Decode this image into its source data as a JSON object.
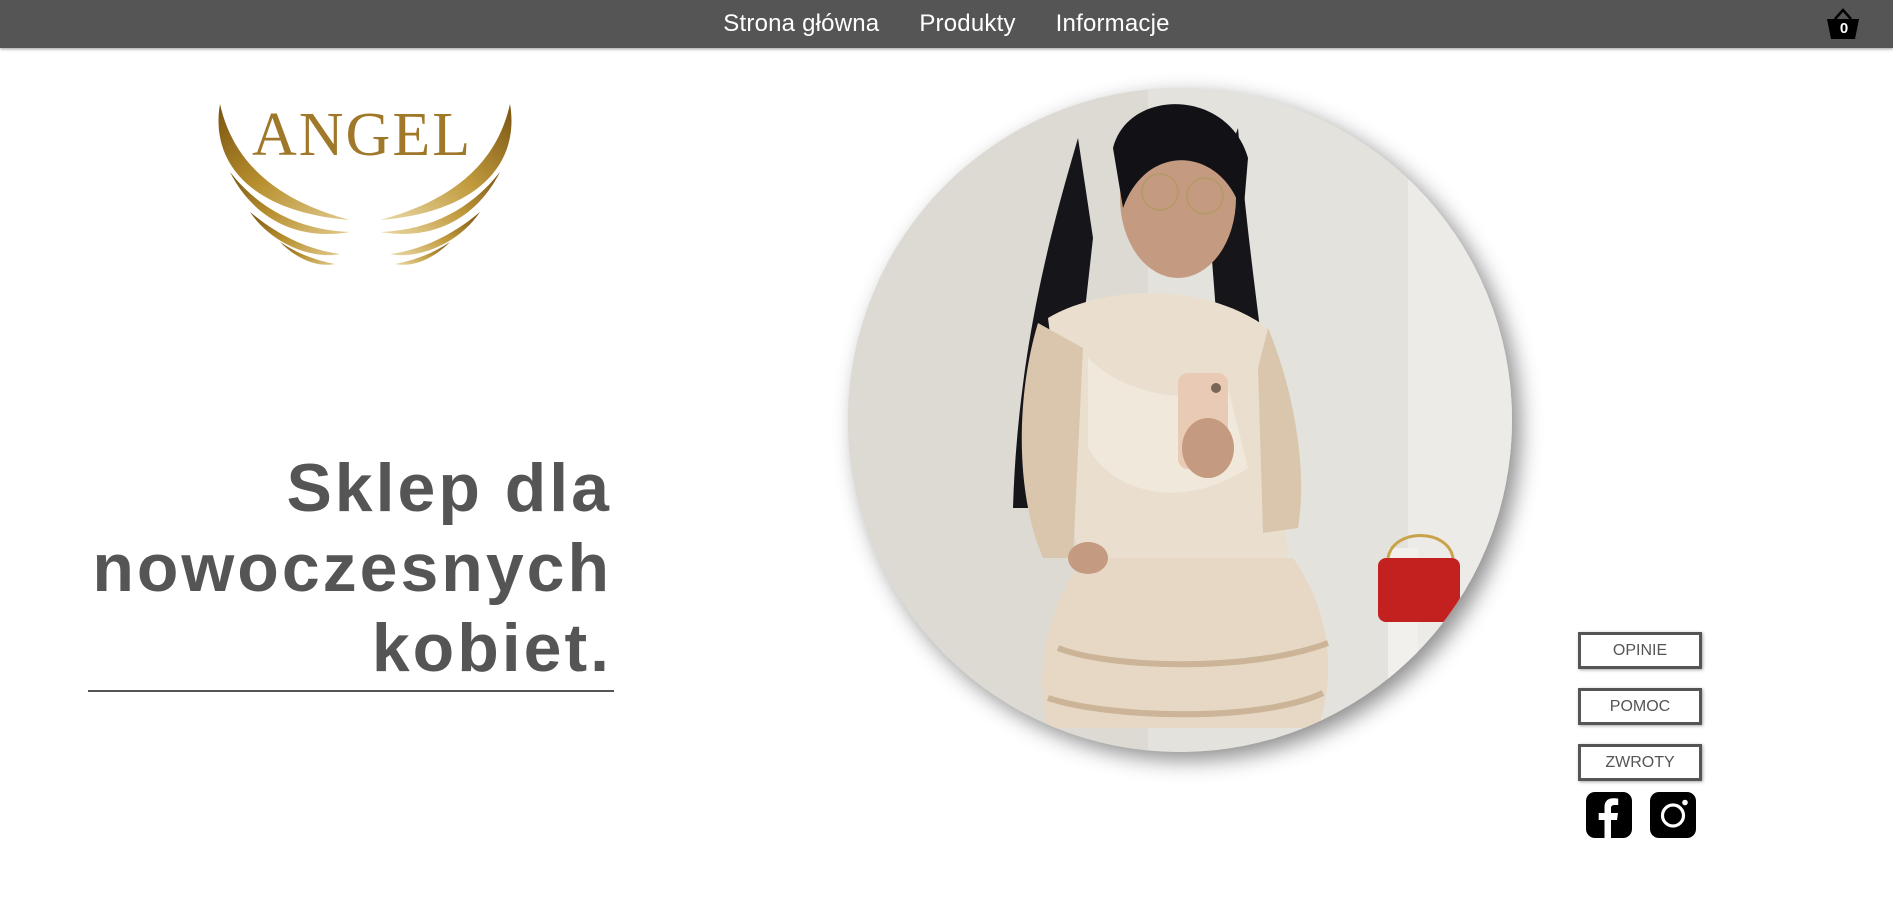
{
  "nav": {
    "items": [
      {
        "label": "Strona główna"
      },
      {
        "label": "Produkty"
      },
      {
        "label": "Informacje"
      }
    ]
  },
  "cart": {
    "count": "0",
    "icon": "basket-icon"
  },
  "logo": {
    "text": "ANGEL",
    "icon": "angel-wings-icon"
  },
  "hero": {
    "headline": [
      "Sklep dla",
      "nowoczesnych",
      "kobiet."
    ],
    "image": "woman-in-dress-photo"
  },
  "side_buttons": [
    {
      "label": "OPINIE"
    },
    {
      "label": "POMOC"
    },
    {
      "label": "ZWROTY"
    }
  ],
  "socials": [
    {
      "icon": "facebook-icon"
    },
    {
      "icon": "instagram-icon"
    }
  ],
  "colors": {
    "topbar": "#555555",
    "text": "#555555",
    "gold": "#a0782a",
    "white": "#ffffff"
  }
}
